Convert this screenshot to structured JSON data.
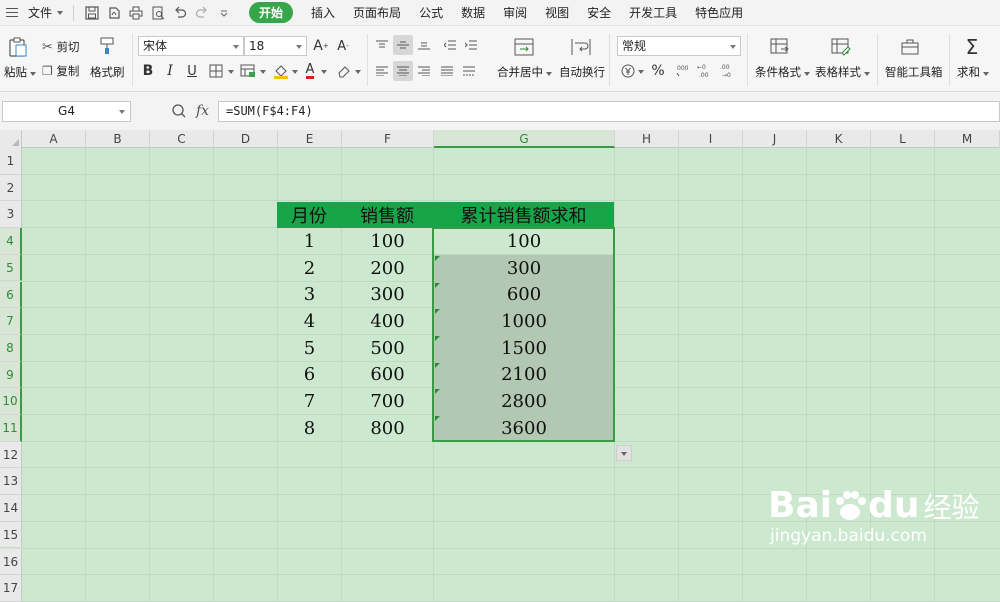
{
  "menu": {
    "file": "文件",
    "tabs": [
      "开始",
      "插入",
      "页面布局",
      "公式",
      "数据",
      "审阅",
      "视图",
      "安全",
      "开发工具",
      "特色应用"
    ],
    "active_tab": "开始"
  },
  "ribbon": {
    "paste": "粘贴",
    "cut": "剪切",
    "copy": "复制",
    "format_painter": "格式刷",
    "font_name": "宋体",
    "font_size": "18",
    "bold": "B",
    "italic": "I",
    "underline": "U",
    "merge_center": "合并居中",
    "wrap_text": "自动换行",
    "number_format": "常规",
    "percent": "%",
    "conditional_format": "条件格式",
    "table_style": "表格样式",
    "smart_toolbox": "智能工具箱",
    "sum": "求和"
  },
  "formula_bar": {
    "name_box": "G4",
    "fx": "fx",
    "formula": "=SUM(F$4:F4)"
  },
  "sheet": {
    "columns": [
      "A",
      "B",
      "C",
      "D",
      "E",
      "F",
      "G",
      "H",
      "I",
      "J",
      "K",
      "L",
      "M"
    ],
    "rows": [
      "1",
      "2",
      "3",
      "4",
      "5",
      "6",
      "7",
      "8",
      "9",
      "10",
      "11",
      "12",
      "13",
      "14",
      "15",
      "16",
      "17"
    ],
    "active_column": "G",
    "table_headers": [
      "月份",
      "销售额",
      "累计销售额求和"
    ],
    "table_rows": [
      {
        "month": "1",
        "sales": "100",
        "cumulative": "100"
      },
      {
        "month": "2",
        "sales": "200",
        "cumulative": "300"
      },
      {
        "month": "3",
        "sales": "300",
        "cumulative": "600"
      },
      {
        "month": "4",
        "sales": "400",
        "cumulative": "1000"
      },
      {
        "month": "5",
        "sales": "500",
        "cumulative": "1500"
      },
      {
        "month": "6",
        "sales": "600",
        "cumulative": "2100"
      },
      {
        "month": "7",
        "sales": "700",
        "cumulative": "2800"
      },
      {
        "month": "8",
        "sales": "800",
        "cumulative": "3600"
      }
    ]
  },
  "watermark": {
    "brand": "Bai",
    "brand2": "du",
    "product": "经验",
    "url": "jingyan.baidu.com"
  },
  "colors": {
    "accent": "#37a64b",
    "header_fill": "#17a54a",
    "sheet_bg": "#cce8cf",
    "selection_fill": "#b2c8b3"
  }
}
